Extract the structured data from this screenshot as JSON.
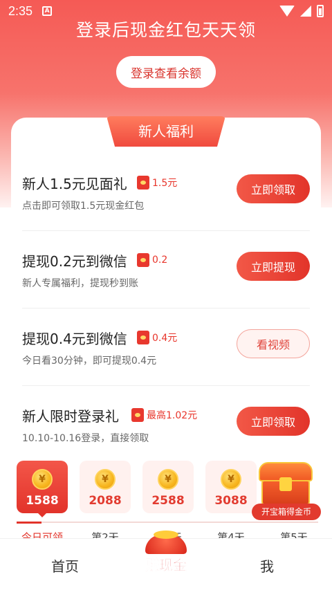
{
  "status_bar": {
    "time": "2:35",
    "notif_letter": "A"
  },
  "header": {
    "headline": "登录后现金红包天天领",
    "balance_button": "登录查看余额"
  },
  "section_tab": "新人福利",
  "tasks": [
    {
      "title": "新人1.5元见面礼",
      "reward": "1.5元",
      "desc": "点击即可领取1.5元现金红包",
      "button": "立即领取"
    },
    {
      "title": "提现0.2元到微信",
      "reward": "0.2",
      "desc": "新人专属福利，提现秒到账",
      "button": "立即提现"
    },
    {
      "title": "提现0.4元到微信",
      "reward": "0.4元",
      "desc": "今日看30分钟，即可提现0.4元",
      "button": "看视频"
    },
    {
      "title": "新人限时登录礼",
      "reward": "最高1.02元",
      "desc": "10.10-10.16登录，直接领取",
      "button": "立即领取"
    }
  ],
  "checkin": {
    "coin_symbol": "¥",
    "days": [
      {
        "amount": "1588",
        "label": "今日可领"
      },
      {
        "amount": "2088",
        "label": "第2天"
      },
      {
        "amount": "2588",
        "label": "第3天"
      },
      {
        "amount": "3088",
        "label": "第4天"
      },
      {
        "amount": "",
        "label": "第5天"
      }
    ],
    "chest_caption": "开宝箱得金币"
  },
  "bottom_nav": {
    "home": "首页",
    "center": "赚现金",
    "me": "我"
  },
  "colors": {
    "accent": "#e2332a",
    "header_gradient_top": "#f55a55"
  }
}
